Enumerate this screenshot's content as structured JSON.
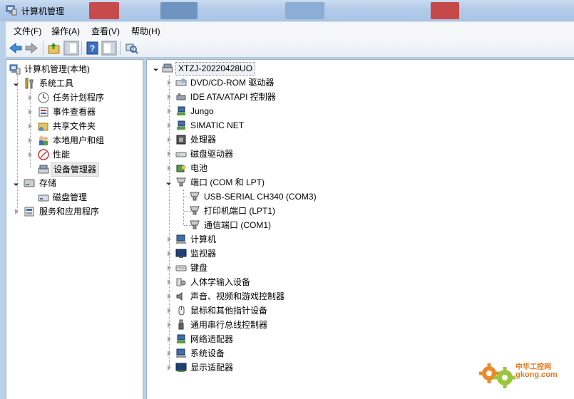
{
  "window": {
    "title": "计算机管理"
  },
  "menu": [
    "文件(F)",
    "操作(A)",
    "查看(V)",
    "帮助(H)"
  ],
  "toolbar": {
    "buttons": [
      "back-arrow-icon",
      "forward-arrow-icon",
      "up-folder-icon",
      "show-hide-tree-icon",
      "help-icon",
      "show-hide-action-pane-icon",
      "scan-hardware-icon"
    ]
  },
  "left_tree": {
    "root": "计算机管理(本地)",
    "system_tools": "系统工具",
    "task_scheduler": "任务计划程序",
    "event_viewer": "事件查看器",
    "shared_folders": "共享文件夹",
    "local_users": "本地用户和组",
    "performance": "性能",
    "device_manager": "设备管理器",
    "storage": "存储",
    "disk_management": "磁盘管理",
    "services_apps": "服务和应用程序"
  },
  "device_tree": {
    "computer_name": "XTZJ-20220428UO",
    "categories": [
      {
        "label": "DVD/CD-ROM 驱动器",
        "icon": "dvd-drive-icon"
      },
      {
        "label": "IDE ATA/ATAPI 控制器",
        "icon": "ide-controller-icon"
      },
      {
        "label": "Jungo",
        "icon": "jungo-device-icon"
      },
      {
        "label": "SIMATIC NET",
        "icon": "simatic-net-icon"
      },
      {
        "label": "处理器",
        "icon": "processor-icon"
      },
      {
        "label": "磁盘驱动器",
        "icon": "disk-drive-icon"
      },
      {
        "label": "电池",
        "icon": "battery-icon"
      },
      {
        "label": "端口 (COM 和 LPT)",
        "icon": "port-icon"
      }
    ],
    "ports": [
      {
        "label": "USB-SERIAL CH340 (COM3)",
        "icon": "port-connector-icon"
      },
      {
        "label": "打印机端口 (LPT1)",
        "icon": "port-connector-icon"
      },
      {
        "label": "通信端口 (COM1)",
        "icon": "port-connector-icon"
      }
    ],
    "categories_after": [
      {
        "label": "计算机",
        "icon": "computer-icon"
      },
      {
        "label": "监视器",
        "icon": "monitor-icon"
      },
      {
        "label": "键盘",
        "icon": "keyboard-icon"
      },
      {
        "label": "人体学输入设备",
        "icon": "hid-icon"
      },
      {
        "label": "声音、视频和游戏控制器",
        "icon": "speaker-icon"
      },
      {
        "label": "鼠标和其他指针设备",
        "icon": "mouse-icon"
      },
      {
        "label": "通用串行总线控制器",
        "icon": "usb-icon"
      },
      {
        "label": "网络适配器",
        "icon": "network-adapter-icon"
      },
      {
        "label": "系统设备",
        "icon": "system-device-icon"
      },
      {
        "label": "显示适配器",
        "icon": "display-adapter-icon"
      }
    ]
  },
  "watermark": {
    "brand": "中华工控网",
    "url": "gkong.com"
  },
  "colors": {
    "titlebar": "#b3cbe8",
    "pane_bg": "#ffffff",
    "border": "#a0aec0",
    "watermark": "#e07a1f"
  }
}
